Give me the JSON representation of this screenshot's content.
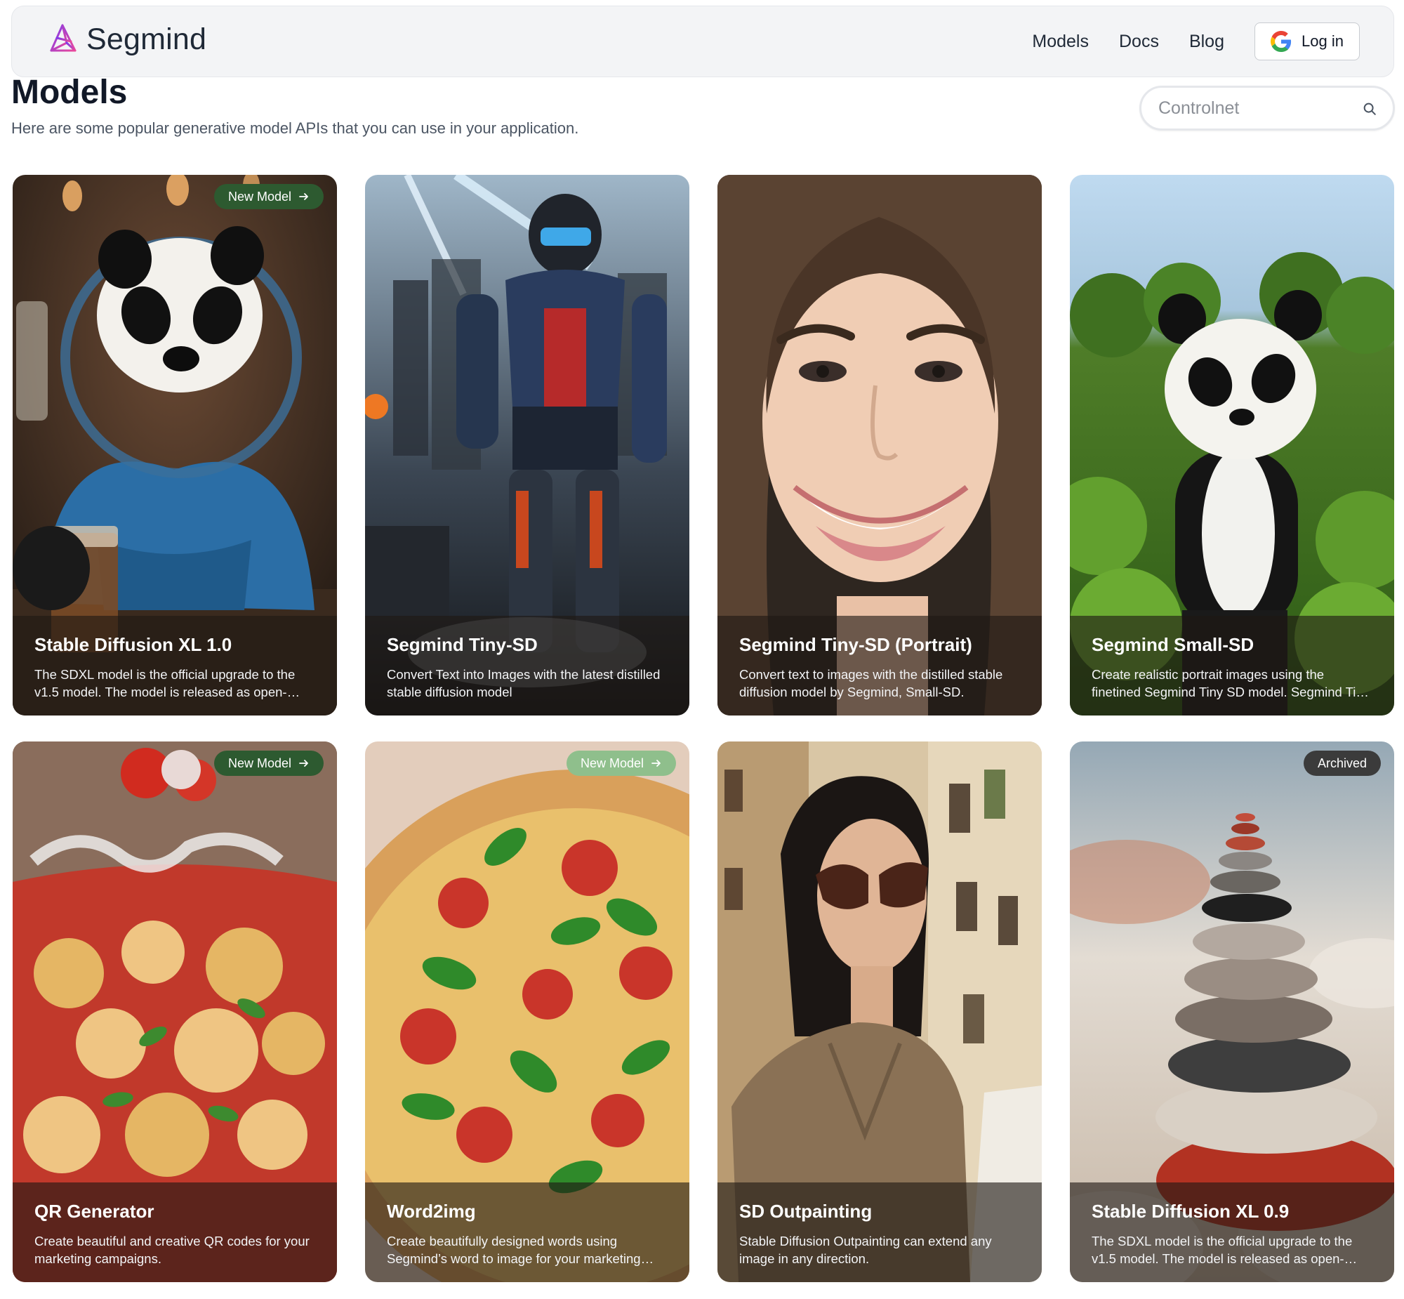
{
  "brand": {
    "name": "Segmind",
    "accent": "#b05be0"
  },
  "nav": {
    "models": "Models",
    "docs": "Docs",
    "blog": "Blog",
    "login": "Log in"
  },
  "page": {
    "title": "Models",
    "subtitle": "Here are some popular generative model APIs that you can use in your application."
  },
  "search": {
    "placeholder": "Controlnet"
  },
  "badges": {
    "new": "New Model",
    "archived": "Archived"
  },
  "cards": [
    {
      "title": "Stable Diffusion XL 1.0",
      "desc": "The SDXL model is the official upgrade to the v1.5 model. The model is released as open-source software.",
      "badge": "New Model"
    },
    {
      "title": "Segmind Tiny-SD",
      "desc": "Convert Text into Images with the latest distilled stable diffusion model"
    },
    {
      "title": "Segmind Tiny-SD (Portrait)",
      "desc": "Convert text to images with the distilled stable diffusion model by Segmind, Small-SD."
    },
    {
      "title": "Segmind Small-SD",
      "desc": "Create realistic portrait images using the finetined Segmind Tiny SD model. Segmind Tiny SD."
    },
    {
      "title": "QR Generator",
      "desc": "Create beautiful and creative QR codes for your marketing campaigns.",
      "badge": "New Model"
    },
    {
      "title": "Word2img",
      "desc": "Create beautifully designed words using Segmind’s word to image for your marketing campaigns.",
      "badge": "New Model"
    },
    {
      "title": "SD Outpainting",
      "desc": "Stable Diffusion Outpainting can extend any image in any direction."
    },
    {
      "title": "Stable Diffusion XL 0.9",
      "desc": "The SDXL model is the official upgrade to the v1.5 model. The model is released as open-source software.",
      "badge": "Archived"
    }
  ]
}
